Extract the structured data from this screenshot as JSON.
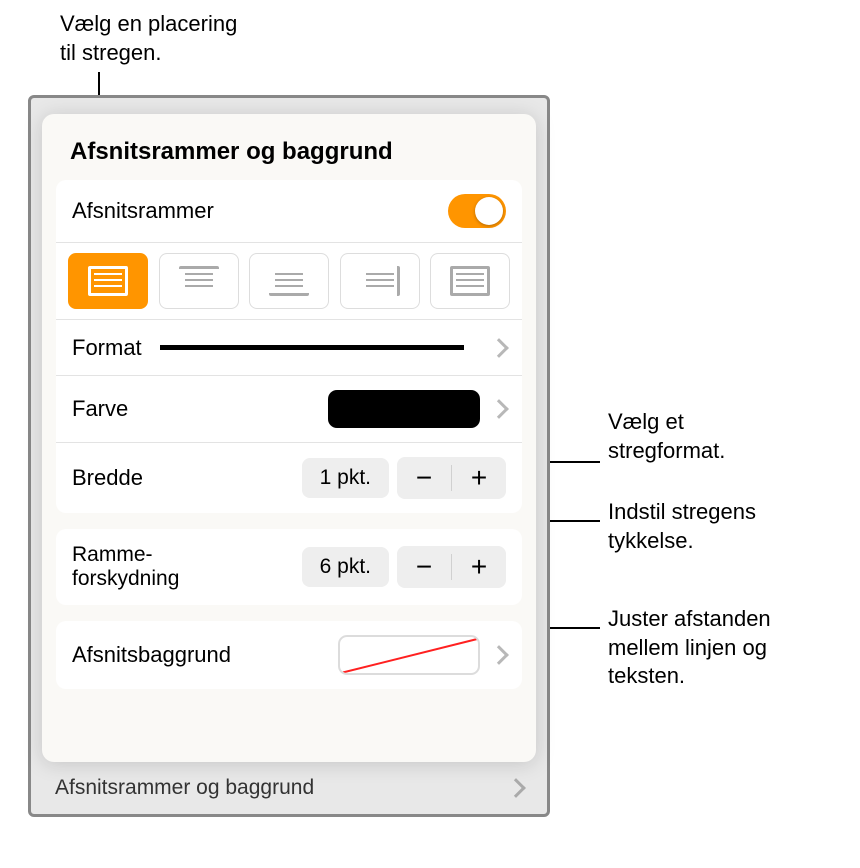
{
  "annotations": {
    "top": "Vælg en placering\ntil stregen.",
    "formatNote": "Vælg et\nstregformat.",
    "widthNote": "Indstil stregens\ntykkelse.",
    "offsetNote": "Juster afstanden\nmellem linjen og\nteksten."
  },
  "panel": {
    "title": "Afsnitsrammer og baggrund",
    "toggleLabel": "Afsnitsrammer",
    "toggleOn": true,
    "format": {
      "label": "Format"
    },
    "color": {
      "label": "Farve",
      "value": "#000000"
    },
    "width": {
      "label": "Bredde",
      "value": "1 pkt."
    },
    "offset": {
      "label": "Ramme-\nforskydning",
      "value": "6 pkt."
    },
    "background": {
      "label": "Afsnitsbaggrund"
    },
    "bottomBar": "Afsnitsrammer og baggrund",
    "borderPositions": [
      {
        "id": "all",
        "selected": true
      },
      {
        "id": "top",
        "selected": false
      },
      {
        "id": "bottom",
        "selected": false
      },
      {
        "id": "right",
        "selected": false
      },
      {
        "id": "box",
        "selected": false
      }
    ]
  }
}
